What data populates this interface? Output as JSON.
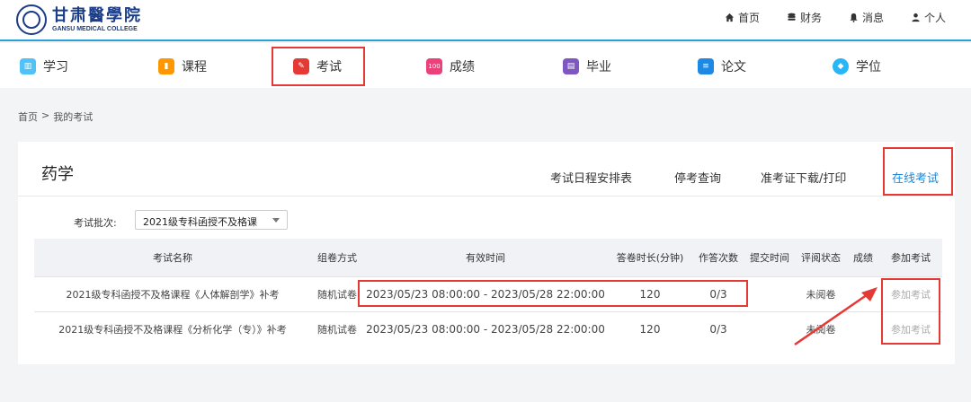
{
  "header": {
    "logo_cn": "甘肃醫學院",
    "logo_en": "GANSU MEDICAL COLLEGE",
    "links": [
      {
        "label": "首页",
        "icon": "home-icon"
      },
      {
        "label": "财务",
        "icon": "database-icon"
      },
      {
        "label": "消息",
        "icon": "bell-icon"
      },
      {
        "label": "个人",
        "icon": "user-icon"
      }
    ]
  },
  "nav": {
    "items": [
      {
        "label": "学习",
        "icon": "study-icon",
        "color": "#4fc3f7"
      },
      {
        "label": "课程",
        "icon": "course-icon",
        "color": "#ff9800"
      },
      {
        "label": "考试",
        "icon": "exam-icon",
        "color": "#e53935"
      },
      {
        "label": "成绩",
        "icon": "score-icon",
        "color": "#ec407a",
        "badge": "100"
      },
      {
        "label": "毕业",
        "icon": "graduate-icon",
        "color": "#7e57c2"
      },
      {
        "label": "论文",
        "icon": "paper-icon",
        "color": "#1e88e5"
      },
      {
        "label": "学位",
        "icon": "degree-icon",
        "color": "#29b6f6"
      }
    ]
  },
  "breadcrumb": {
    "home": "首页",
    "sep": ">",
    "current": "我的考试"
  },
  "panel": {
    "title": "药学",
    "tabs": [
      {
        "label": "考试日程安排表",
        "active": false
      },
      {
        "label": "停考查询",
        "active": false
      },
      {
        "label": "准考证下载/打印",
        "active": false
      },
      {
        "label": "在线考试",
        "active": true
      }
    ],
    "batch_label": "考试批次:",
    "batch_value": "2021级专科函授不及格课"
  },
  "table": {
    "headers": [
      "考试名称",
      "组卷方式",
      "有效时间",
      "答卷时长(分钟)",
      "作答次数",
      "提交时间",
      "评阅状态",
      "成绩",
      "参加考试"
    ],
    "rows": [
      {
        "name": "2021级专科函授不及格课程《人体解剖学》补考",
        "method": "随机试卷",
        "time": "2023/05/23 08:00:00 - 2023/05/28 22:00:00",
        "duration": "120",
        "attempts": "0/3",
        "submit": "",
        "review": "未阅卷",
        "score": "",
        "join": "参加考试"
      },
      {
        "name": "2021级专科函授不及格课程《分析化学（专）》补考",
        "method": "随机试卷",
        "time": "2023/05/23 08:00:00 - 2023/05/28 22:00:00",
        "duration": "120",
        "attempts": "0/3",
        "submit": "",
        "review": "未阅卷",
        "score": "",
        "join": "参加考试"
      }
    ]
  },
  "colors": {
    "accent": "#1e88d8",
    "highlight": "#e53935",
    "header_border": "#2a9fd8"
  }
}
